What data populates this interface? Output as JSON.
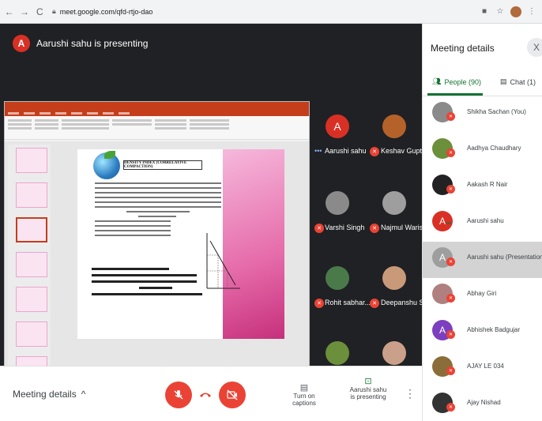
{
  "browser": {
    "url": "meet.google.com/qfd-rtjo-dao",
    "back_icon": "←",
    "forward_icon": "→",
    "reload_icon": "C"
  },
  "presenter": {
    "initial": "A",
    "text": "Aarushi sahu is presenting"
  },
  "slide": {
    "heading": "DENSITY INDEX (CORRELATIVE COMPACTION)"
  },
  "participants": [
    {
      "name": "Aarushi sahu",
      "initial": "A",
      "avatar_color": "#d93025",
      "muted": false
    },
    {
      "name": "Keshav Gupta",
      "avatar_color": "#b5622a",
      "muted": true
    },
    {
      "name": "Varshi Singh",
      "avatar_color": "#8a8a8a",
      "muted": true
    },
    {
      "name": "Najmul Waris",
      "avatar_color": "#9e9e9e",
      "muted": true
    },
    {
      "name": "Rohit sabhar...",
      "avatar_color": "#4a7a4a",
      "muted": true
    },
    {
      "name": "Deepanshu S...",
      "avatar_color": "#c99a7a",
      "muted": true
    },
    {
      "name": "",
      "avatar_color": "#6b8f3a",
      "muted": true
    },
    {
      "name": "",
      "avatar_color": "#caa08a",
      "muted": true
    }
  ],
  "bottom_bar": {
    "meeting_details": "Meeting details",
    "captions_label": "Turn on captions",
    "presenting_line1": "Aarushi sahu",
    "presenting_line2": "is presenting"
  },
  "panel": {
    "title": "Meeting details",
    "close": "X",
    "people_tab": "People (90)",
    "chat_tab": "Chat (1)",
    "people": [
      {
        "name": "Shikha Sachan (You)",
        "avatar_color": "#8a8a8a",
        "initial": ""
      },
      {
        "name": "Aadhya Chaudhary",
        "avatar_color": "#6b8f3a",
        "initial": ""
      },
      {
        "name": "Aakash R Nair",
        "avatar_color": "#222222",
        "initial": ""
      },
      {
        "name": "Aarushi sahu",
        "avatar_color": "#d93025",
        "initial": "A"
      },
      {
        "name": "Aarushi sahu (Presentation)",
        "avatar_color": "#9e9e9e",
        "initial": "A"
      },
      {
        "name": "Abhay Giri",
        "avatar_color": "#b08080",
        "initial": ""
      },
      {
        "name": "Abhishek Badgujar",
        "avatar_color": "#7b3fbf",
        "initial": "A"
      },
      {
        "name": "AJAY LE 034",
        "avatar_color": "#8b6d3a",
        "initial": ""
      },
      {
        "name": "Ajay Nishad",
        "avatar_color": "#333333",
        "initial": ""
      }
    ]
  }
}
